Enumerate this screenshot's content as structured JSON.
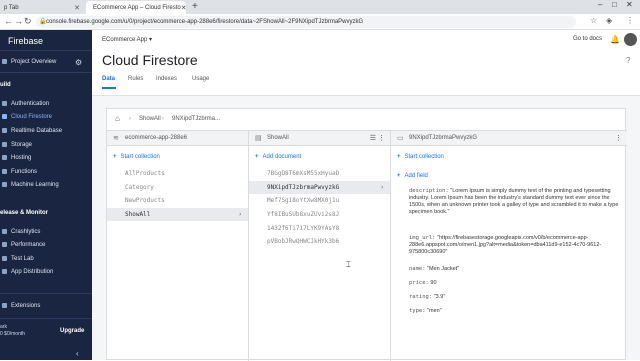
{
  "browser": {
    "tabs": [
      {
        "label": "p Tab"
      },
      {
        "label": "ECommerce App – Cloud Firesto"
      }
    ],
    "new_tab": "+",
    "url": "console.firebase.google.com/u/0/project/ecommerce-app-288e6/firestore/data~2FShowAll~2F9NXipdTJzbrmaPwvyzkG"
  },
  "sidebar": {
    "brand": "Firebase",
    "project_overview": "Project Overview",
    "sections": [
      {
        "title": "uild",
        "items": [
          "Authentication",
          "Cloud Firestore",
          "Realtime Database",
          "Storage",
          "Hosting",
          "Functions",
          "Machine Learning"
        ]
      },
      {
        "title": "elease & Monitor",
        "items": [
          "Crashlytics",
          "Performance",
          "Test Lab",
          "App Distribution"
        ]
      }
    ],
    "extensions": "Extensions",
    "plan_line1": "ark",
    "plan_line2": "0 $0/month",
    "upgrade": "Upgrade",
    "active_item": "Cloud Firestore"
  },
  "header": {
    "project": "ECommerce App",
    "goto_docs": "Go to docs",
    "title": "Cloud Firestore",
    "tabs": [
      "Data",
      "Rules",
      "Indexes",
      "Usage"
    ],
    "active_tab": "Data"
  },
  "breadcrumb": {
    "items": [
      "ShowAll",
      "9NXipdTJzbrma..."
    ]
  },
  "root_column": {
    "header": "ecommerce-app-288e6",
    "action": "Start collection",
    "items": [
      "AllProducts",
      "Category",
      "NewProducts",
      "ShowAll"
    ],
    "selected": "ShowAll"
  },
  "collection_column": {
    "header": "ShowAll",
    "action": "Add document",
    "items": [
      "7BGgD8T6mXsM55xHyuaD",
      "9NXipdTJzbrmaPwvyzkG",
      "Mef7Sg18oYtXw8MX0j1u",
      "Yf8IBuSUb8xuZUvi2s8J",
      "1432f6Ti717LYK9YAsY8",
      "pVBobJRwQHWCJkHYk3b6"
    ],
    "selected": "9NXipdTJzbrmaPwvyzkG"
  },
  "document_column": {
    "header": "9NXipdTJzbrmaPwvyzkG",
    "action_collection": "Start collection",
    "action_field": "Add field",
    "fields": [
      {
        "key": "description:",
        "value": "\"Lorem Ipsum is simply dummy text of the printing and typesetting industry. Lorem Ipsum has been the industry's standard dummy text ever since the 1500s, when an unknown printer took a galley of type and scrambled it to make a type specimen book.\""
      },
      {
        "key": "img_url:",
        "value": "\"https://firebasestorage.googleapis.com/v0/b/ecommerce-app-288e6.appspot.com/o/men1.jpg?alt=media&token=dba411d9-e152-4c70-9612-975800c30690\""
      },
      {
        "key": "name:",
        "value": "\"Men Jacket\""
      },
      {
        "key": "price:",
        "value": "90"
      },
      {
        "key": "rating:",
        "value": "\"3.9\""
      },
      {
        "key": "type:",
        "value": "\"men\""
      }
    ]
  }
}
